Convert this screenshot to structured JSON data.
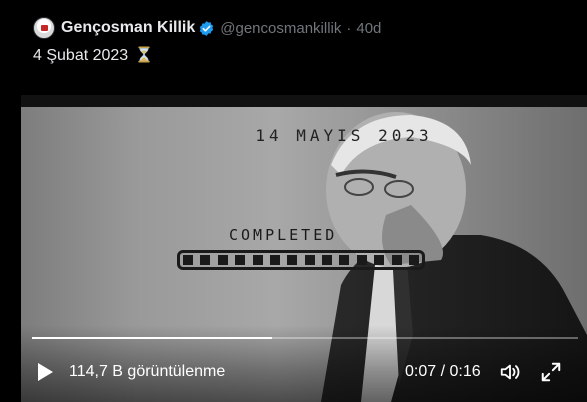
{
  "author": {
    "name": "Gençosman Killik",
    "handle": "@gencosmankillik",
    "separator": "·",
    "age": "40d",
    "verified": true
  },
  "tweet": {
    "text": "4 Şubat 2023",
    "emoji_icon": "hourglass-icon"
  },
  "video": {
    "date_text": "14 MAYIS 2023",
    "completed_text": "COMPLETED",
    "progress_segments": 14,
    "progress_fraction": 1.0,
    "playback_fraction": 0.44,
    "views": "114,7 B görüntülenme",
    "time": "0:07 / 0:16"
  },
  "colors": {
    "accent": "#1d9bf0",
    "text": "#e7e9ea",
    "muted": "#71767b"
  }
}
